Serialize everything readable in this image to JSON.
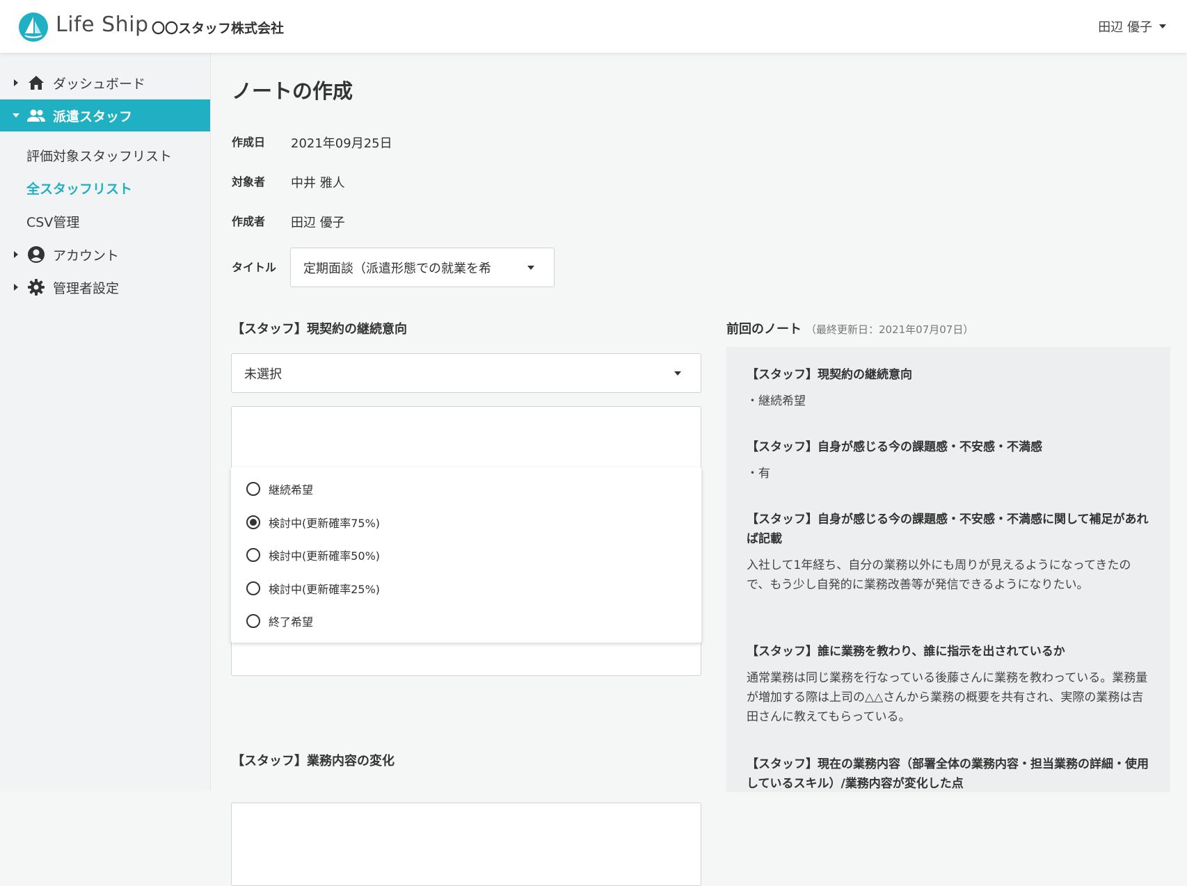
{
  "header": {
    "brand": "Life Ship",
    "company": "〇〇スタッフ株式会社",
    "user": "田辺 優子"
  },
  "sidebar": {
    "items": [
      {
        "label": "ダッシュボード",
        "icon": "home-icon"
      },
      {
        "label": "派遣スタッフ",
        "icon": "people-icon",
        "active": true
      },
      {
        "label": "アカウント",
        "icon": "account-circle-icon"
      },
      {
        "label": "管理者設定",
        "icon": "gear-icon"
      }
    ],
    "subitems": [
      {
        "label": "評価対象スタッフリスト"
      },
      {
        "label": "全スタッフリスト",
        "current": true
      },
      {
        "label": "CSV管理"
      }
    ]
  },
  "main": {
    "title": "ノートの作成",
    "fields": {
      "created_label": "作成日",
      "created_value": "2021年09月25日",
      "target_label": "対象者",
      "target_value": "中井 雅人",
      "author_label": "作成者",
      "author_value": "田辺 優子",
      "title_label": "タイトル",
      "title_value": "定期面談（派遣形態での就業を希"
    },
    "section1": {
      "label": "【スタッフ】現契約の継続意向",
      "select_value": "未選択",
      "options": [
        "継続希望",
        "検討中(更新確率75%)",
        "検討中(更新確率50%)",
        "検討中(更新確率25%)",
        "終了希望"
      ],
      "selected_index": 1
    },
    "section2": {
      "label": "【スタッフ】業務内容の変化"
    }
  },
  "previous_note": {
    "title": "前回のノート",
    "updated": "（最終更新日：2021年07月07日）",
    "entries": [
      {
        "heading": "【スタッフ】現契約の継続意向",
        "body": "・継続希望"
      },
      {
        "heading": "【スタッフ】自身が感じる今の課題感・不安感・不満感",
        "body": "・有"
      },
      {
        "heading": "【スタッフ】自身が感じる今の課題感・不安感・不満感に関して補足があれば記載",
        "body": "入社して1年経ち、自分の業務以外にも周りが見えるようになってきたので、もう少し自発的に業務改善等が発信できるようになりたい。"
      },
      {
        "heading": "【スタッフ】誰に業務を教わり、誰に指示を出されているか",
        "body": "通常業務は同じ業務を行なっている後藤さんに業務を教わっている。業務量が増加する際は上司の△△さんから業務の概要を共有され、実際の業務は吉田さんに教えてもらっている。"
      },
      {
        "heading": "【スタッフ】現在の業務内容（部署全体の業務内容・担当業務の詳細・使用しているスキル）/業務内容が変化した点",
        "body": ""
      }
    ]
  },
  "colors": {
    "accent": "#1fb0c3",
    "sidebar_bg": "#f1f3f4",
    "panel_bg": "#eceeef"
  }
}
